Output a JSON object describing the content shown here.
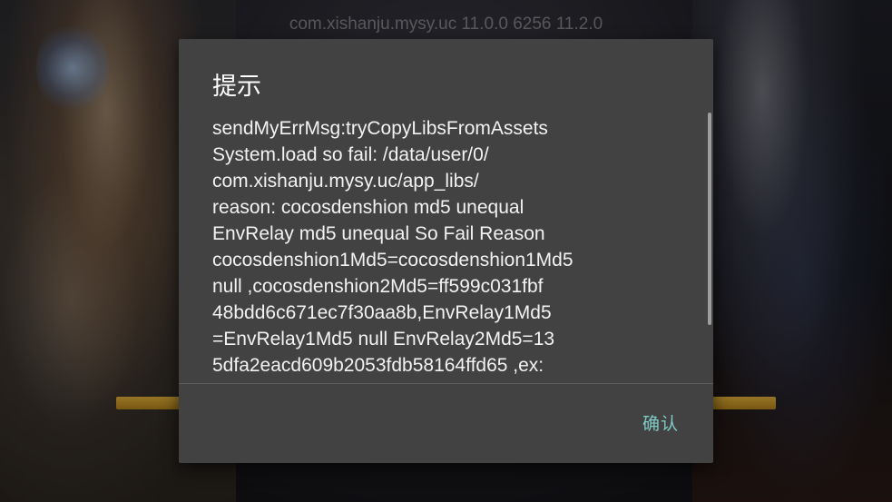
{
  "background": {
    "version_text": "com.xishanju.mysy.uc 11.0.0 6256 11.2.0"
  },
  "dialog": {
    "title": "提示",
    "message_lines": [
      "sendMyErrMsg:tryCopyLibsFromAssets",
      "System.load so fail: /data/user/0/",
      "com.xishanju.mysy.uc/app_libs/",
      "reason: cocosdenshion md5 unequal",
      "EnvRelay md5 unequal So Fail Reason",
      "cocosdenshion1Md5=cocosdenshion1Md5",
      "null ,cocosdenshion2Md5=ff599c031fbf",
      "48bdd6c671ec7f30aa8b,EnvRelay1Md5",
      "=EnvRelay1Md5 null EnvRelay2Md5=13",
      "5dfa2eacd609b2053fdb58164ffd65 ,ex:"
    ],
    "confirm_label": "确认"
  },
  "colors": {
    "dialog_bg": "#424242",
    "accent": "#80cbc4",
    "text": "#f2f2f2"
  }
}
